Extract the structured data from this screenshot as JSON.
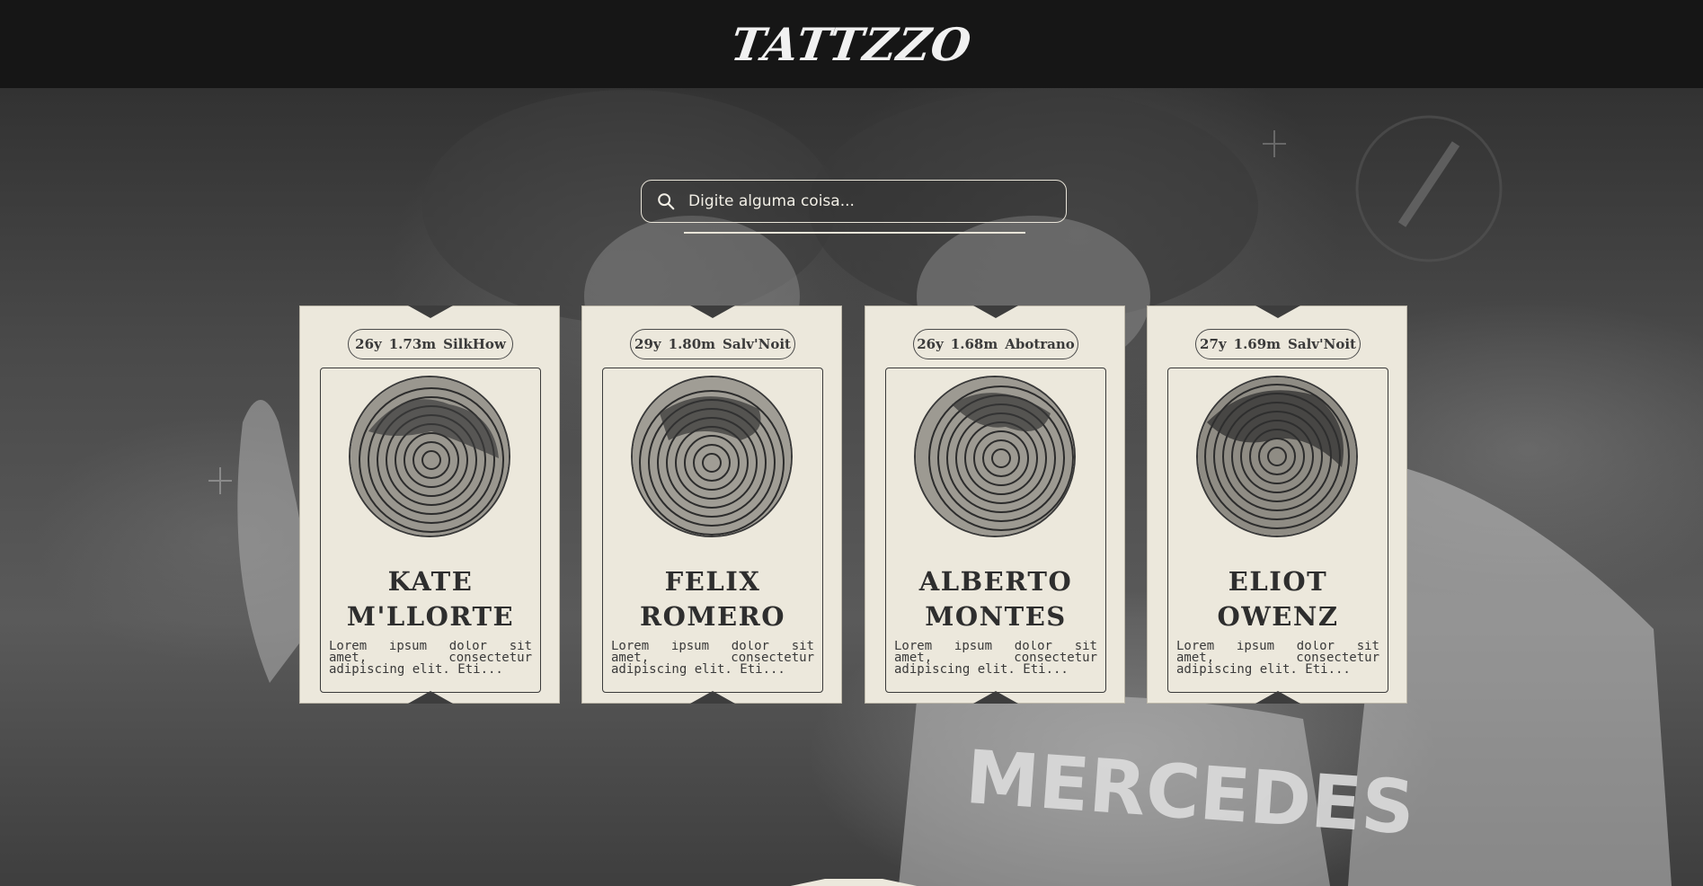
{
  "header": {
    "logo_text": "TATTZZO"
  },
  "search": {
    "placeholder": "Digite alguma coisa..."
  },
  "artists": [
    {
      "age": "26y",
      "height": "1.73m",
      "style": "SilkHow",
      "name_line1": "KATE",
      "name_line2": "M'LLORTE",
      "description": "Lorem ipsum dolor sit amet, consectetur adipiscing elit. Eti..."
    },
    {
      "age": "29y",
      "height": "1.80m",
      "style": "Salv'Noit",
      "name_line1": "FELIX",
      "name_line2": "ROMERO",
      "description": "Lorem ipsum dolor sit amet, consectetur adipiscing elit. Eti..."
    },
    {
      "age": "26y",
      "height": "1.68m",
      "style": "Abotrano",
      "name_line1": "ALBERTO",
      "name_line2": "MONTES",
      "description": "Lorem ipsum dolor sit amet, consectetur adipiscing elit. Eti..."
    },
    {
      "age": "27y",
      "height": "1.69m",
      "style": "Salv'Noit",
      "name_line1": "ELIOT",
      "name_line2": "OWENZ",
      "description": "Lorem ipsum dolor sit amet, consectetur adipiscing elit. Eti..."
    }
  ],
  "background": {
    "jacket_text": "MERCEDES"
  },
  "colors": {
    "header_bg": "#161616",
    "card_bg": "#ece8dc",
    "ink": "#2e2e2e"
  }
}
